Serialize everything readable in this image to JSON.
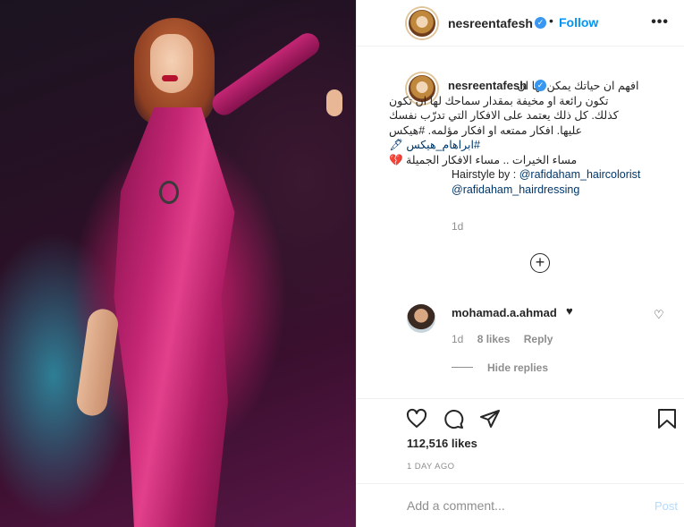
{
  "header": {
    "username": "nesreentafesh",
    "follow_label": "Follow",
    "separator": "•",
    "more_label": "•••"
  },
  "caption": {
    "username": "nesreentafesh",
    "lines": [
      "افهم ان حياتك يمكن لها ان",
      "تكون رائعة او مخيفة بمقدار سماحك لها ان تكون",
      "كذلك. كل ذلك يعتمد على الافكار التي تدرّب نفسك",
      "عليها. افكار ممتعه او افكار مؤلمه. #هيكس",
      "#ابراهام_هيكس 🖋",
      "مساء الخيرات .. مساء الافكار الجميلة 💔"
    ],
    "hairstyle_prefix": "Hairstyle by : ",
    "mention1": "@rafidaham_haircolorist",
    "mention2": "@rafidaham_hairdressing",
    "time": "1d"
  },
  "comment": {
    "username": "mohamad.a.ahmad",
    "text": "♥",
    "time": "1d",
    "likes": "8 likes",
    "reply_label": "Reply",
    "hide_replies_label": "Hide replies"
  },
  "actions": {
    "likes_count": "112,516 likes",
    "time_ago": "1 DAY AGO"
  },
  "add_comment": {
    "placeholder": "Add a comment...",
    "post_label": "Post"
  },
  "icons": [
    "verified-badge-icon",
    "more-options-icon",
    "add-circle-icon",
    "heart-icon",
    "comment-icon",
    "share-icon",
    "bookmark-icon"
  ],
  "colors": {
    "link": "#00376b",
    "follow": "#0095f6",
    "verified": "#3897f0",
    "muted": "#8e8e8e"
  }
}
